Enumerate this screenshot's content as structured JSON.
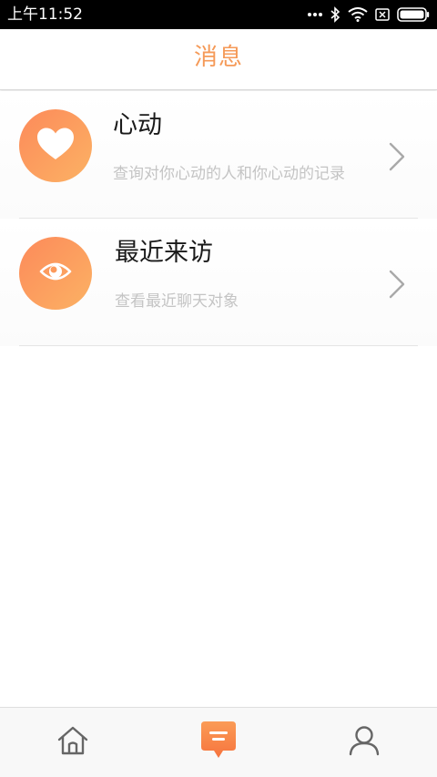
{
  "status_bar": {
    "time": "上午11:52",
    "icons": [
      "more-dots-icon",
      "bluetooth-icon",
      "wifi-icon",
      "sim-off-icon",
      "battery-icon"
    ]
  },
  "header": {
    "title": "消息"
  },
  "list": {
    "items": [
      {
        "title": "心动",
        "subtitle": "查询对你心动的人和你心动的记录",
        "icon": "heart-icon"
      },
      {
        "title": "最近来访",
        "subtitle": "查看最近聊天对象",
        "icon": "eye-icon"
      }
    ]
  },
  "bottom_nav": {
    "items": [
      {
        "icon": "home-icon",
        "active": false
      },
      {
        "icon": "message-icon",
        "active": true
      },
      {
        "icon": "profile-icon",
        "active": false
      }
    ]
  },
  "colors": {
    "accent": "#f59a58",
    "avatar_gradient_start": "#fd8a5a",
    "avatar_gradient_end": "#fbb264",
    "subtitle": "#c4c4c4",
    "nav_icon": "#666666"
  }
}
